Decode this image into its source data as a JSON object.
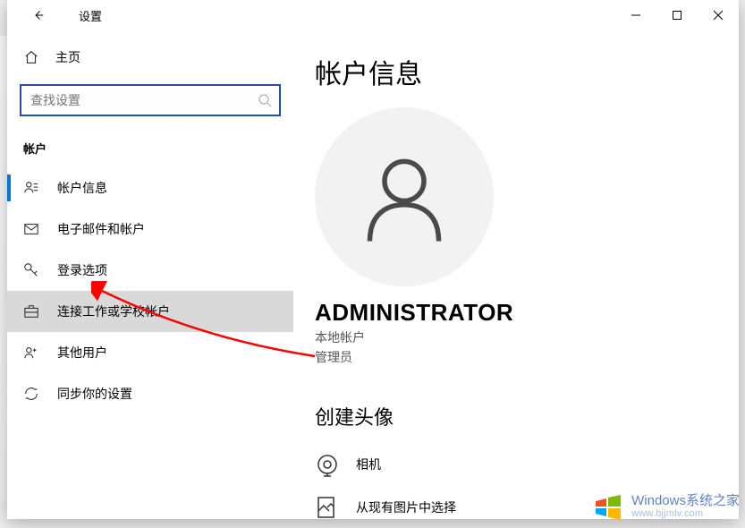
{
  "titlebar": {
    "back_tooltip": "返回",
    "title": "设置"
  },
  "sidebar": {
    "home_label": "主页",
    "search_placeholder": "查找设置",
    "section_label": "帐户",
    "items": [
      {
        "label": "帐户信息",
        "icon": "account-info"
      },
      {
        "label": "电子邮件和帐户",
        "icon": "email"
      },
      {
        "label": "登录选项",
        "icon": "key"
      },
      {
        "label": "连接工作或学校帐户",
        "icon": "briefcase"
      },
      {
        "label": "其他用户",
        "icon": "other-users"
      },
      {
        "label": "同步你的设置",
        "icon": "sync"
      }
    ]
  },
  "main": {
    "page_title": "帐户信息",
    "username": "ADMINISTRATOR",
    "account_type": "本地帐户",
    "role": "管理员",
    "avatar_section_title": "创建头像",
    "options": [
      {
        "label": "相机",
        "icon": "camera"
      },
      {
        "label": "从现有图片中选择",
        "icon": "browse"
      }
    ]
  },
  "watermark": {
    "brand": "Windows",
    "brand_suffix": "系统之家",
    "domain": "www.bjjmlv.com"
  }
}
